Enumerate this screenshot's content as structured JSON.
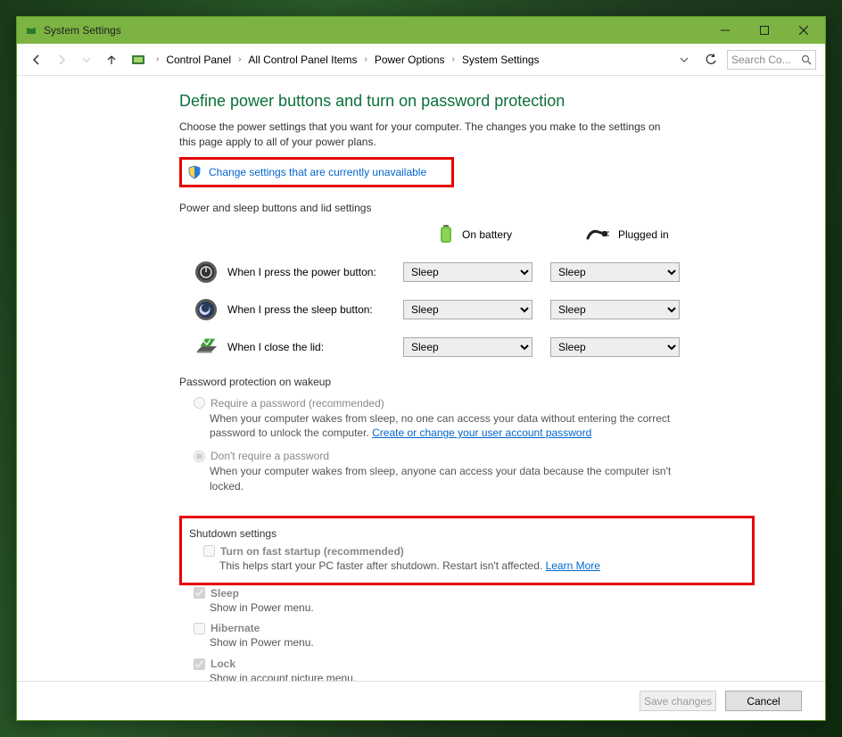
{
  "window": {
    "title": "System Settings"
  },
  "breadcrumbs": {
    "items": [
      "Control Panel",
      "All Control Panel Items",
      "Power Options",
      "System Settings"
    ]
  },
  "search": {
    "placeholder": "Search Co..."
  },
  "page": {
    "title": "Define power buttons and turn on password protection",
    "subtitle": "Choose the power settings that you want for your computer. The changes you make to the settings on this page apply to all of your power plans.",
    "change_link": "Change settings that are currently unavailable"
  },
  "power_section": {
    "label": "Power and sleep buttons and lid settings",
    "col_battery": "On battery",
    "col_plugged": "Plugged in",
    "rows": {
      "power_btn": {
        "label": "When I press the power button:",
        "battery": "Sleep",
        "plugged": "Sleep"
      },
      "sleep_btn": {
        "label": "When I press the sleep button:",
        "battery": "Sleep",
        "plugged": "Sleep"
      },
      "lid": {
        "label": "When I close the lid:",
        "battery": "Sleep",
        "plugged": "Sleep"
      }
    }
  },
  "password_section": {
    "label": "Password protection on wakeup",
    "opt1": {
      "label": "Require a password (recommended)",
      "desc_a": "When your computer wakes from sleep, no one can access your data without entering the correct password to unlock the computer. ",
      "link": "Create or change your user account password"
    },
    "opt2": {
      "label": "Don't require a password",
      "desc": "When your computer wakes from sleep, anyone can access your data because the computer isn't locked."
    }
  },
  "shutdown_section": {
    "label": "Shutdown settings",
    "fast": {
      "label": "Turn on fast startup (recommended)",
      "desc_a": "This helps start your PC faster after shutdown. Restart isn't affected. ",
      "link": "Learn More"
    },
    "sleep": {
      "label": "Sleep",
      "desc": "Show in Power menu."
    },
    "hibernate": {
      "label": "Hibernate",
      "desc": "Show in Power menu."
    },
    "lock": {
      "label": "Lock",
      "desc": "Show in account picture menu."
    }
  },
  "footer": {
    "save": "Save changes",
    "cancel": "Cancel"
  }
}
